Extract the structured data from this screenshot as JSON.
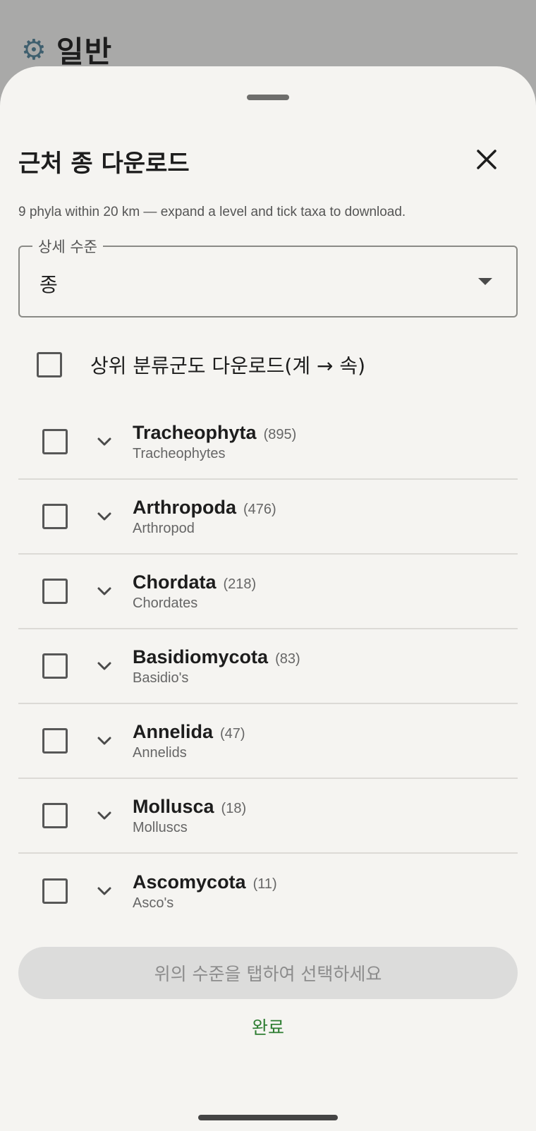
{
  "background_screen": {
    "title": "일반",
    "icon": "gear-icon"
  },
  "sheet": {
    "title": "근처 종 다운로드",
    "close_icon": "close-icon",
    "subtitle": "9 phyla within 20 km — expand a level and tick taxa to download.",
    "detail_level": {
      "label": "상세 수준",
      "value": "종"
    },
    "higher_taxa": {
      "label": "상위 분류군도 다운로드(계 → 속)",
      "checked": false
    },
    "phyla": [
      {
        "name": "Tracheophyta",
        "count": "(895)",
        "common": "Tracheophytes",
        "checked": false
      },
      {
        "name": "Arthropoda",
        "count": "(476)",
        "common": "Arthropod",
        "checked": false
      },
      {
        "name": "Chordata",
        "count": "(218)",
        "common": "Chordates",
        "checked": false
      },
      {
        "name": "Basidiomycota",
        "count": "(83)",
        "common": "Basidio's",
        "checked": false
      },
      {
        "name": "Annelida",
        "count": "(47)",
        "common": "Annelids",
        "checked": false
      },
      {
        "name": "Mollusca",
        "count": "(18)",
        "common": "Molluscs",
        "checked": false
      },
      {
        "name": "Ascomycota",
        "count": "(11)",
        "common": "Asco's",
        "checked": false
      }
    ],
    "select_button": "위의 수준을 탭하여 선택하세요",
    "done_button": "완료"
  },
  "colors": {
    "sheet_background": "#f5f4f1",
    "scrim": "#a9a9a8",
    "accent_green": "#2e7d32",
    "disabled_button": "#dcdcdb"
  }
}
